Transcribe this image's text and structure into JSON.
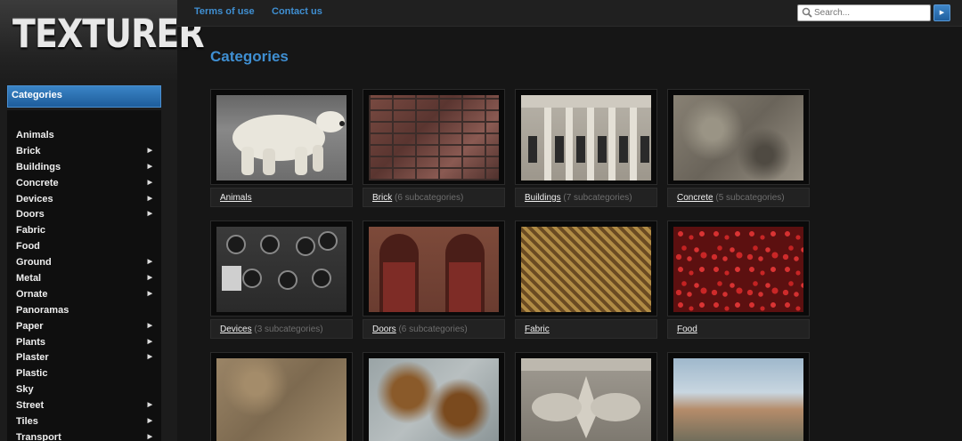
{
  "app": {
    "logo_text": "TEXTURER"
  },
  "topnav": {
    "links": [
      "Terms of use",
      "Contact us"
    ]
  },
  "search": {
    "placeholder": "Search..."
  },
  "sidebar": {
    "header": "Categories",
    "items": [
      {
        "label": "Animals",
        "has_sub": false
      },
      {
        "label": "Brick",
        "has_sub": true
      },
      {
        "label": "Buildings",
        "has_sub": true
      },
      {
        "label": "Concrete",
        "has_sub": true
      },
      {
        "label": "Devices",
        "has_sub": true
      },
      {
        "label": "Doors",
        "has_sub": true
      },
      {
        "label": "Fabric",
        "has_sub": false
      },
      {
        "label": "Food",
        "has_sub": false
      },
      {
        "label": "Ground",
        "has_sub": true
      },
      {
        "label": "Metal",
        "has_sub": true
      },
      {
        "label": "Ornate",
        "has_sub": true
      },
      {
        "label": "Panoramas",
        "has_sub": false
      },
      {
        "label": "Paper",
        "has_sub": true
      },
      {
        "label": "Plants",
        "has_sub": true
      },
      {
        "label": "Plaster",
        "has_sub": true
      },
      {
        "label": "Plastic",
        "has_sub": false
      },
      {
        "label": "Sky",
        "has_sub": false
      },
      {
        "label": "Street",
        "has_sub": true
      },
      {
        "label": "Tiles",
        "has_sub": true
      },
      {
        "label": "Transport",
        "has_sub": true
      }
    ]
  },
  "main": {
    "title": "Categories",
    "cards": [
      {
        "name": "Animals",
        "sub": "",
        "texture": "animals"
      },
      {
        "name": "Brick",
        "sub": "(6 subcategories)",
        "texture": "brick"
      },
      {
        "name": "Buildings",
        "sub": "(7 subcategories)",
        "texture": "buildings"
      },
      {
        "name": "Concrete",
        "sub": "(5 subcategories)",
        "texture": "concrete"
      },
      {
        "name": "Devices",
        "sub": "(3 subcategories)",
        "texture": "devices"
      },
      {
        "name": "Doors",
        "sub": "(6 subcategories)",
        "texture": "doors"
      },
      {
        "name": "Fabric",
        "sub": "",
        "texture": "fabric"
      },
      {
        "name": "Food",
        "sub": "",
        "texture": "food"
      },
      {
        "name": "",
        "sub": "",
        "texture": "ground"
      },
      {
        "name": "",
        "sub": "",
        "texture": "metal"
      },
      {
        "name": "",
        "sub": "",
        "texture": "ornate"
      },
      {
        "name": "",
        "sub": "",
        "texture": "panoramas"
      }
    ]
  },
  "colors": {
    "accent": "#3f8fd2",
    "header_blue": "#2a6fb0",
    "background": "#161616"
  }
}
